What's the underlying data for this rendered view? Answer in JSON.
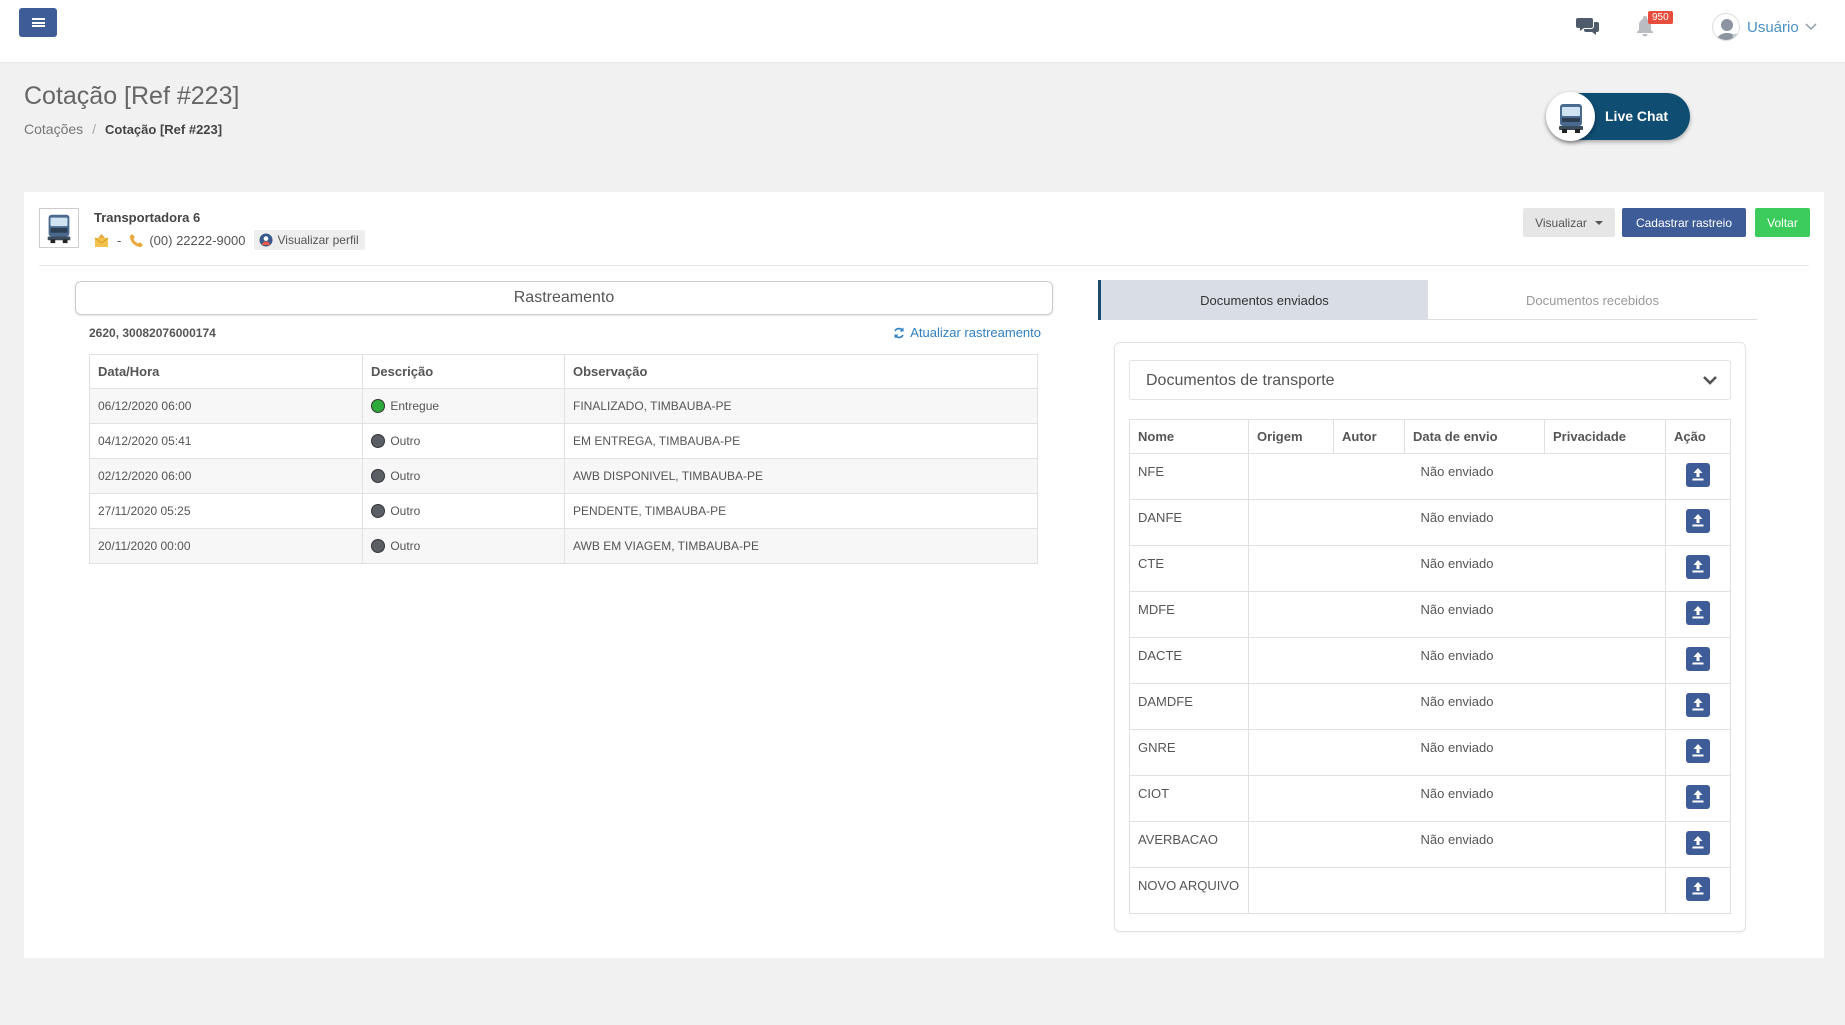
{
  "header": {
    "notification_count": "950",
    "user_name": "Usuário"
  },
  "page": {
    "title": "Cotação [Ref #223]",
    "breadcrumb": [
      "Cotações",
      "Cotação [Ref #223]"
    ],
    "live_chat_label": "Live Chat"
  },
  "carrier": {
    "name": "Transportadora 6",
    "email_separator": "-",
    "phone": "(00) 22222-9000",
    "profile_button": "Visualizar perfil"
  },
  "actions": {
    "view_label": "Visualizar",
    "register_tracking_label": "Cadastrar rastreio",
    "back_label": "Voltar"
  },
  "tracking": {
    "title": "Rastreamento",
    "reference": "2620, 30082076000174",
    "refresh_label": "Atualizar rastreamento",
    "columns": [
      "Data/Hora",
      "Descrição",
      "Observação"
    ],
    "rows": [
      {
        "datetime": "06/12/2020 06:00",
        "status": "Entregue",
        "status_color": "#2eaa3a",
        "note": "FINALIZADO, TIMBAUBA-PE"
      },
      {
        "datetime": "04/12/2020 05:41",
        "status": "Outro",
        "status_color": "#5a5f66",
        "note": "EM ENTREGA, TIMBAUBA-PE"
      },
      {
        "datetime": "02/12/2020 06:00",
        "status": "Outro",
        "status_color": "#5a5f66",
        "note": "AWB DISPONIVEL, TIMBAUBA-PE"
      },
      {
        "datetime": "27/11/2020 05:25",
        "status": "Outro",
        "status_color": "#5a5f66",
        "note": "PENDENTE, TIMBAUBA-PE"
      },
      {
        "datetime": "20/11/2020 00:00",
        "status": "Outro",
        "status_color": "#5a5f66",
        "note": "AWB EM VIAGEM, TIMBAUBA-PE"
      }
    ]
  },
  "documents": {
    "tabs": [
      "Documentos enviados",
      "Documentos recebidos"
    ],
    "active_tab": "Documentos enviados",
    "section_title": "Documentos de transporte",
    "columns": [
      "Nome",
      "Origem",
      "Autor",
      "Data de envio",
      "Privacidade",
      "Ação"
    ],
    "rows": [
      {
        "name": "NFE",
        "status": "Não enviado"
      },
      {
        "name": "DANFE",
        "status": "Não enviado"
      },
      {
        "name": "CTE",
        "status": "Não enviado"
      },
      {
        "name": "MDFE",
        "status": "Não enviado"
      },
      {
        "name": "DACTE",
        "status": "Não enviado"
      },
      {
        "name": "DAMDFE",
        "status": "Não enviado"
      },
      {
        "name": "GNRE",
        "status": "Não enviado"
      },
      {
        "name": "CIOT",
        "status": "Não enviado"
      },
      {
        "name": "AVERBACAO",
        "status": "Não enviado"
      },
      {
        "name": "NOVO ARQUIVO",
        "status": ""
      }
    ]
  },
  "colors": {
    "primary": "#3e5c98",
    "success": "#3ccc5b",
    "live_chat": "#0f4d73",
    "link": "#2f7fc1",
    "badge": "#e74c3c"
  }
}
